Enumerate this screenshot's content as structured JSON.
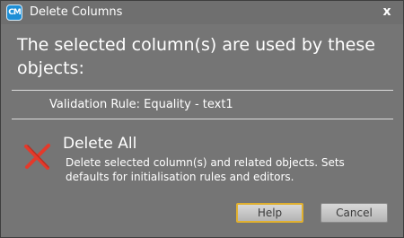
{
  "window": {
    "title": "Delete Columns",
    "app_icon_text": "CM",
    "close_glyph": "x"
  },
  "content": {
    "heading": "The selected column(s) are used by these objects:",
    "objects": [
      "Validation Rule: Equality - text1"
    ]
  },
  "option": {
    "icon": "red-x-icon",
    "title": "Delete All",
    "description": "Delete selected column(s) and related objects. Sets defaults for initialisation rules and editors."
  },
  "buttons": {
    "help": "Help",
    "cancel": "Cancel"
  }
}
